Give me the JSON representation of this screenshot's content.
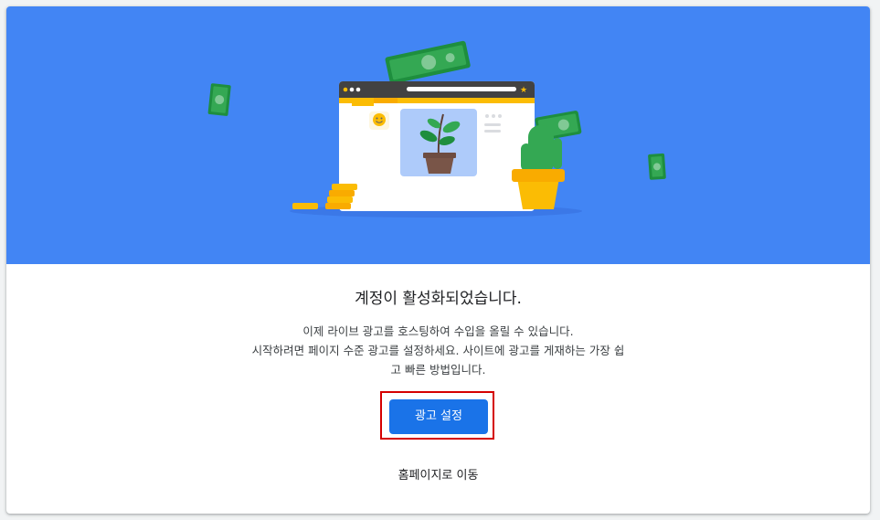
{
  "hero": {
    "background": "#4285f4",
    "illustration": "browser-window-with-plant-cactus-money-coins"
  },
  "content": {
    "title": "계정이 활성화되었습니다.",
    "description_lines": [
      "이제 라이브 광고를 호스팅하여 수입을 올릴 수 있습니다.",
      "시작하려면 페이지 수준 광고를 설정하세요. 사이트에 광고를 게재하는 가장 쉽",
      "고 빠른 방법입니다."
    ]
  },
  "actions": {
    "primary_label": "광고 설정",
    "primary_color": "#1a73e8",
    "highlight_color": "#d50000",
    "secondary_label": "홈페이지로 이동"
  }
}
